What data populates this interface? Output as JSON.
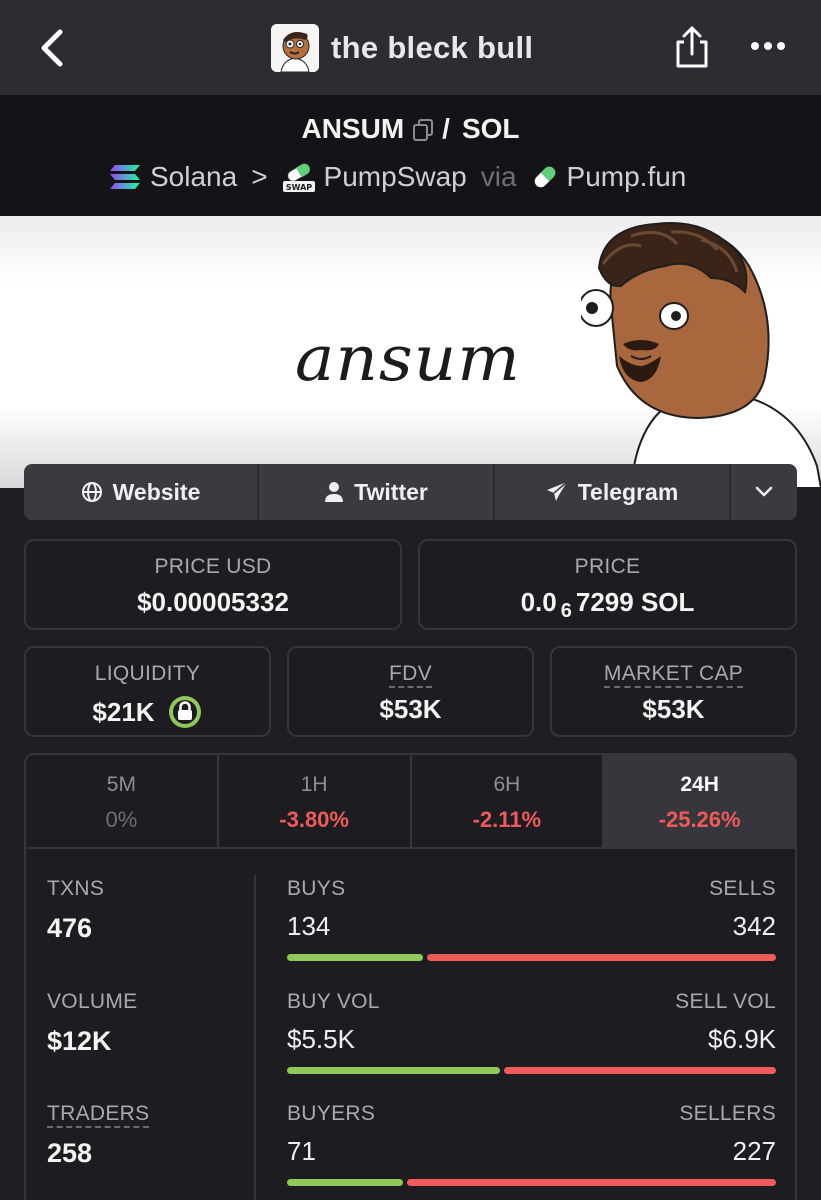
{
  "header": {
    "title": "the bleck bull"
  },
  "pair": {
    "base": "ANSUM",
    "sep": "/",
    "quote": "SOL",
    "chain": "Solana",
    "chevron": ">",
    "dex": "PumpSwap",
    "via": "via",
    "launchpad": "Pump.fun",
    "dex_badge": "SWAP"
  },
  "banner": {
    "text": "ansum"
  },
  "socials": {
    "website": "Website",
    "twitter": "Twitter",
    "telegram": "Telegram"
  },
  "price": {
    "usd_label": "PRICE USD",
    "usd_value": "$0.00005332",
    "native_label": "PRICE",
    "native_prefix": "0.0",
    "native_zeros": "6",
    "native_digits": "7299 SOL"
  },
  "metrics": {
    "liquidity_label": "LIQUIDITY",
    "liquidity_value": "$21K",
    "fdv_label": "FDV",
    "fdv_value": "$53K",
    "mcap_label": "MARKET CAP",
    "mcap_value": "$53K"
  },
  "timeframes": [
    {
      "label": "5M",
      "value": "0%"
    },
    {
      "label": "1H",
      "value": "-3.80%"
    },
    {
      "label": "6H",
      "value": "-2.11%"
    },
    {
      "label": "24H",
      "value": "-25.26%"
    }
  ],
  "stats": {
    "txns_label": "TXNS",
    "txns_value": "476",
    "volume_label": "VOLUME",
    "volume_value": "$12K",
    "traders_label": "TRADERS",
    "traders_value": "258",
    "buys_label": "BUYS",
    "sells_label": "SELLS",
    "buys_value": "134",
    "sells_value": "342",
    "buyvol_label": "BUY VOL",
    "sellvol_label": "SELL VOL",
    "buyvol_value": "$5.5K",
    "sellvol_value": "$6.9K",
    "buyers_label": "BUYERS",
    "sellers_label": "SELLERS",
    "buyers_value": "71",
    "sellers_value": "227",
    "buys_share": 0.28,
    "buyvol_share": 0.44,
    "buyers_share": 0.24
  },
  "colors": {
    "positive": "#8fc95a",
    "negative": "#ef5a5a"
  }
}
